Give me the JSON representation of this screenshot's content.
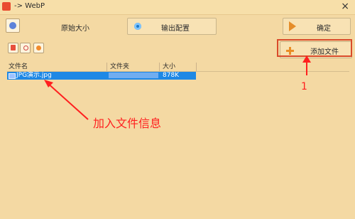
{
  "window": {
    "title": "-> WebP",
    "close_symbol": "×"
  },
  "header": {
    "original_size_label": "原始大小",
    "output_config_label": "输出配置",
    "confirm_label": "确定"
  },
  "actions": {
    "add_file_label": "添加文件"
  },
  "table": {
    "headers": [
      "文件名",
      "文件夹",
      "大小"
    ],
    "rows": [
      {
        "name": "JPG演示.jpg",
        "folder": "",
        "size": "878K"
      }
    ]
  },
  "annotations": {
    "note": "加入文件信息",
    "number": "1",
    "color": "#ff1f1f"
  },
  "colors": {
    "background": "#f4d9a3",
    "selection": "#1e88e5",
    "highlight_border": "#d94b2b"
  }
}
